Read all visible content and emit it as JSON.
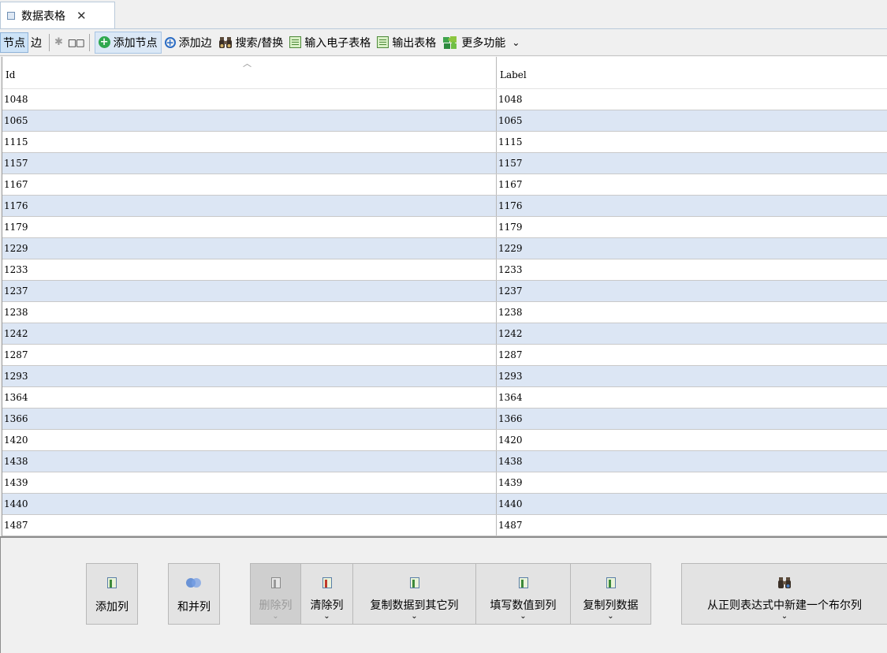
{
  "tab": {
    "title": "数据表格",
    "close": "✕"
  },
  "toolbar": {
    "nodes_label": "节点",
    "edges_label": "边",
    "squares": "□□",
    "add_node": "添加节点",
    "add_edge": "添加边",
    "search_replace": "搜索/替换",
    "import_sheet": "输入电子表格",
    "export_table": "输出表格",
    "more": "更多功能",
    "more_chevron": "⌄"
  },
  "table": {
    "columns": [
      "Id",
      "Label"
    ],
    "sort_indicator": "︿",
    "rows": [
      [
        "1048",
        "1048"
      ],
      [
        "1065",
        "1065"
      ],
      [
        "1115",
        "1115"
      ],
      [
        "1157",
        "1157"
      ],
      [
        "1167",
        "1167"
      ],
      [
        "1176",
        "1176"
      ],
      [
        "1179",
        "1179"
      ],
      [
        "1229",
        "1229"
      ],
      [
        "1233",
        "1233"
      ],
      [
        "1237",
        "1237"
      ],
      [
        "1238",
        "1238"
      ],
      [
        "1242",
        "1242"
      ],
      [
        "1287",
        "1287"
      ],
      [
        "1293",
        "1293"
      ],
      [
        "1364",
        "1364"
      ],
      [
        "1366",
        "1366"
      ],
      [
        "1420",
        "1420"
      ],
      [
        "1438",
        "1438"
      ],
      [
        "1439",
        "1439"
      ],
      [
        "1440",
        "1440"
      ],
      [
        "1487",
        "1487"
      ]
    ]
  },
  "actions": {
    "add_column": "添加列",
    "merge_columns": "和并列",
    "delete_column": "删除列",
    "clear_column": "清除列",
    "copy_to_other": "复制数据到其它列",
    "fill_values": "填写数值到列",
    "copy_column": "复制列数据",
    "regex_boolean": "从正则表达式中新建一个布尔列",
    "chevron": "⌄"
  },
  "colors": {
    "row_alt": "#dce6f4",
    "selected_toggle": "#cde3f7",
    "accent_green": "#2fa84f",
    "accent_blue": "#2b6cc4"
  }
}
